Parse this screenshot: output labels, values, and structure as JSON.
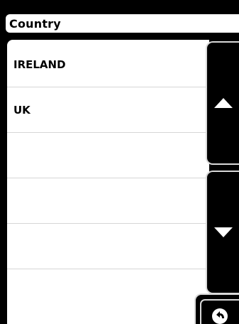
{
  "header": {
    "title": "Country"
  },
  "country_list": {
    "items": [
      {
        "label": "IRELAND"
      },
      {
        "label": "UK"
      },
      {
        "label": ""
      },
      {
        "label": ""
      },
      {
        "label": ""
      }
    ]
  },
  "controls": {
    "scroll_up_icon": "triangle-up-icon",
    "scroll_down_icon": "triangle-down-icon",
    "back_icon": "back-arrow-icon"
  },
  "colors": {
    "background": "#000000",
    "panel": "#ffffff",
    "divider": "#d6d6d6",
    "button_border": "#d9d9d9"
  }
}
